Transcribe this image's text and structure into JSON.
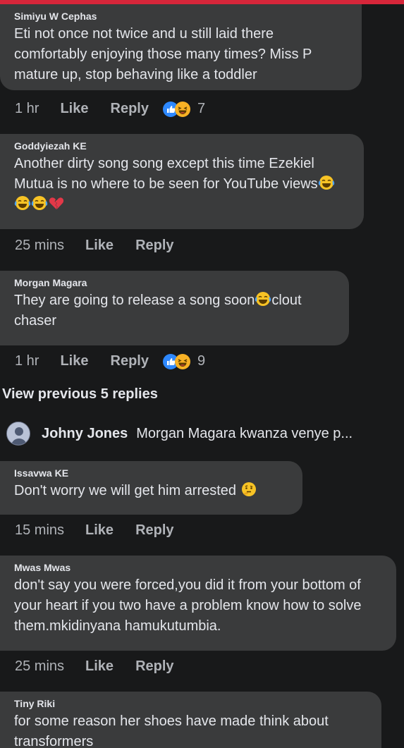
{
  "comments": [
    {
      "author": "Simiyu W Cephas",
      "text": "Eti not once not twice and u still laid there comfortably enjoying those many times? Miss P mature up, stop behaving like a toddler",
      "time": "1 hr",
      "like_label": "Like",
      "reply_label": "Reply",
      "reactions": [
        "like-icon",
        "laughing-icon"
      ],
      "reaction_count": "7"
    },
    {
      "author": "Goddyiezah KE",
      "text": "Another dirty song song except this time Ezekiel Mutua is no where to be seen for YouTube views",
      "emojis": [
        "tears-of-joy-icon",
        "tears-of-joy-icon",
        "tears-of-joy-icon",
        "broken-heart-icon"
      ],
      "time": "25 mins",
      "like_label": "Like",
      "reply_label": "Reply"
    },
    {
      "author": "Morgan Magara",
      "text_before": "They are going to release a song soon",
      "text_after": "clout chaser",
      "inline_emoji": "tears-of-joy-icon",
      "time": "1 hr",
      "like_label": "Like",
      "reply_label": "Reply",
      "reactions": [
        "like-icon",
        "laughing-icon"
      ],
      "reaction_count": "9"
    },
    {
      "author": "Issavwa KE",
      "text": "Don't worry we will get him arrested",
      "inline_emoji": "thinking-face-icon",
      "time": "15 mins",
      "like_label": "Like",
      "reply_label": "Reply"
    },
    {
      "author": "Mwas Mwas",
      "text": "don't say you were forced,you did it from your bottom of your heart if you two have a problem know how to solve them.mkidinyana hamukutumbia.",
      "time": "25 mins",
      "like_label": "Like",
      "reply_label": "Reply"
    },
    {
      "author": "Tiny Riki",
      "text": "for some reason her shoes have made think about transformers"
    }
  ],
  "view_previous": "View previous 5 replies",
  "collapsed_reply": {
    "author": "Johny Jones",
    "snippet": "Morgan Magara kwanza venye p..."
  },
  "colors": {
    "background": "#18191a",
    "bubble": "#3a3b3c",
    "text": "#e4e6eb",
    "meta": "#b0b3b8",
    "like_reaction": "#2d88ff",
    "laugh_reaction": "#f7b125",
    "top_bar": "#d6263a"
  }
}
